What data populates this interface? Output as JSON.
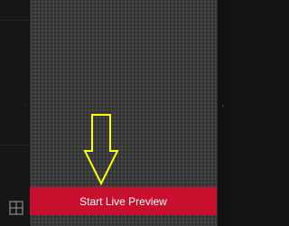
{
  "preview": {
    "start_button_label": "Start Live Preview"
  },
  "colors": {
    "button": "#c8102e",
    "arrow": "#ffff00",
    "panel": "#3a3a3a",
    "background": "#141414"
  },
  "icons": {
    "layout_grid": "grid-icon",
    "annotation": "down-arrow-icon"
  }
}
